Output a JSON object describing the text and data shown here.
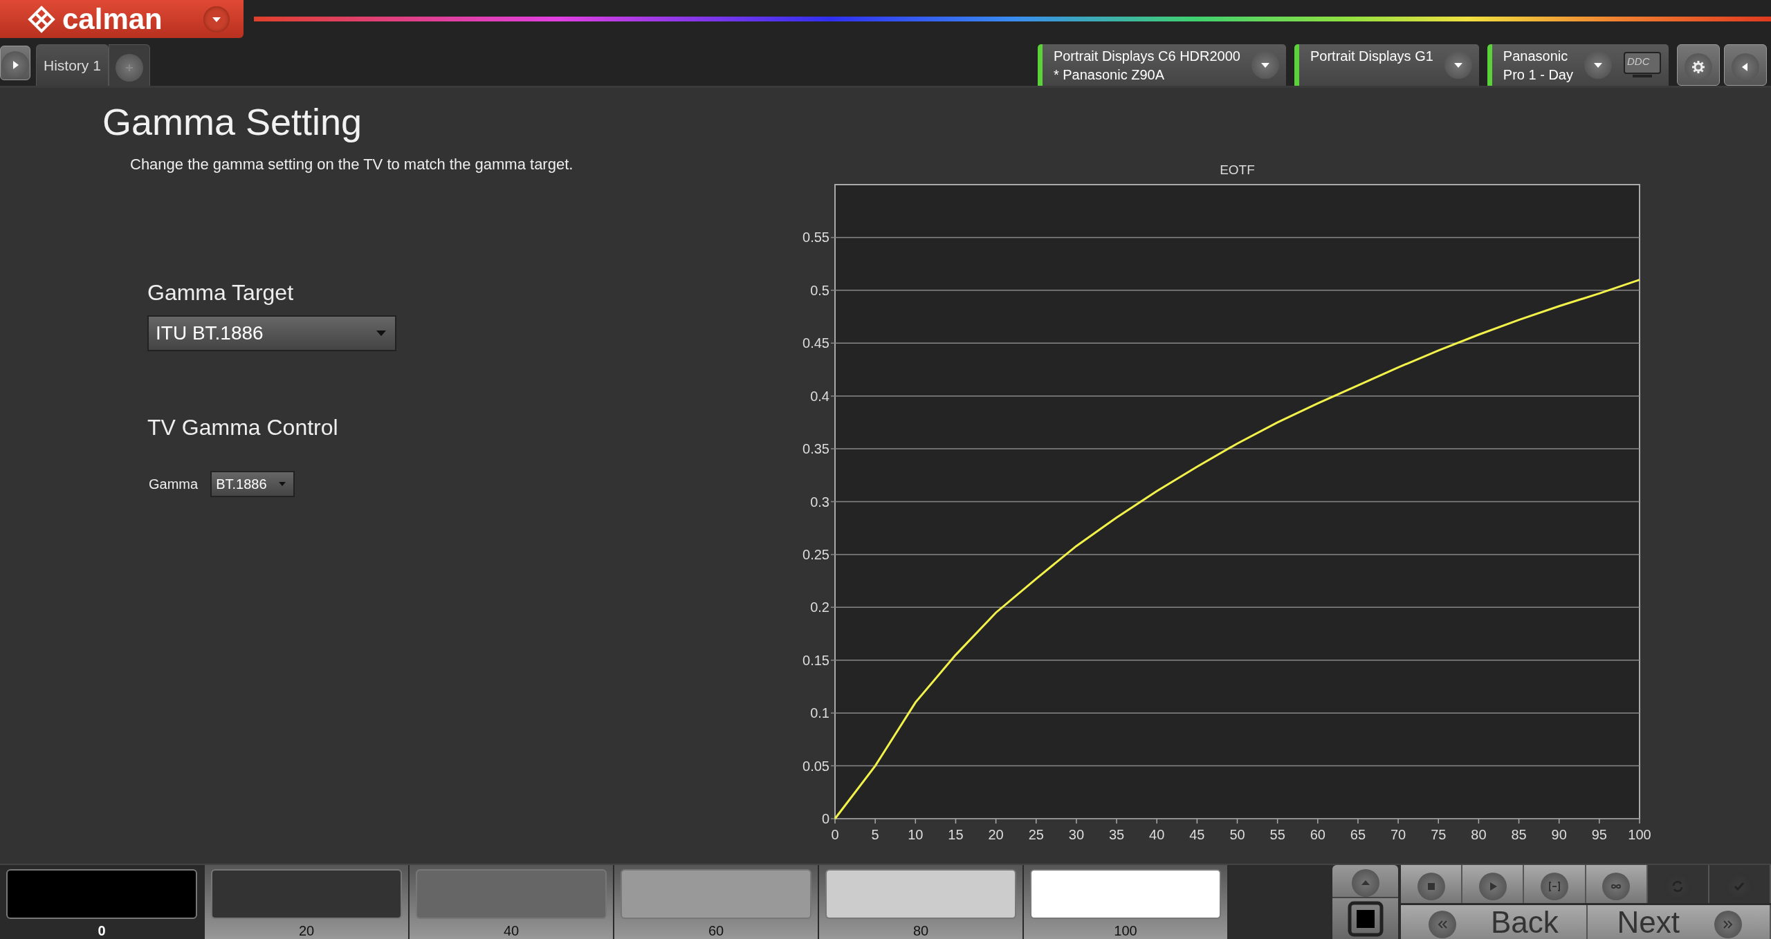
{
  "app": {
    "logo": "calman",
    "ddc": "DDC"
  },
  "tabs": [
    {
      "label": "History 1",
      "selected": true
    }
  ],
  "devices": [
    {
      "lines": [
        "Portrait Displays C6 HDR2000",
        "* Panasonic Z90A"
      ],
      "connected": true
    },
    {
      "lines": [
        "Portrait Displays G1"
      ],
      "connected": true
    },
    {
      "lines": [
        "Panasonic",
        "Pro 1 - Day"
      ],
      "connected": true
    }
  ],
  "page": {
    "title": "Gamma Setting",
    "instruction": "Change the gamma setting on the TV to match the gamma target."
  },
  "gamma_target": {
    "label": "Gamma Target",
    "value": "ITU BT.1886"
  },
  "tv_control": {
    "heading": "TV Gamma Control",
    "fields": [
      {
        "label": "Gamma",
        "value": "BT.1886"
      }
    ]
  },
  "chart_data": {
    "type": "line",
    "title": "EOTF",
    "x": [
      0,
      5,
      10,
      15,
      20,
      25,
      30,
      35,
      40,
      45,
      50,
      55,
      60,
      65,
      70,
      75,
      80,
      85,
      90,
      95,
      100
    ],
    "grid": true,
    "series": [
      {
        "color": "#f2f24a",
        "values": [
          0,
          0.05,
          0.11,
          0.155,
          0.195,
          0.227,
          0.258,
          0.285,
          0.31,
          0.333,
          0.355,
          0.375,
          0.393,
          0.41,
          0.427,
          0.443,
          0.458,
          0.472,
          0.485,
          0.497,
          0.51
        ]
      }
    ],
    "xlim": [
      0,
      100
    ],
    "ylim": [
      0,
      0.6
    ],
    "xticks": [
      0,
      5,
      10,
      15,
      20,
      25,
      30,
      35,
      40,
      45,
      50,
      55,
      60,
      65,
      70,
      75,
      80,
      85,
      90,
      95,
      100
    ],
    "yticks": [
      0,
      0.05,
      0.1,
      0.15,
      0.2,
      0.25,
      0.3,
      0.35,
      0.4,
      0.45,
      0.5,
      0.55
    ]
  },
  "patches": [
    {
      "label": "0",
      "color": "#000000",
      "selected": true
    },
    {
      "label": "20",
      "color": "#333333",
      "selected": false
    },
    {
      "label": "40",
      "color": "#666666",
      "selected": false
    },
    {
      "label": "60",
      "color": "#999999",
      "selected": false
    },
    {
      "label": "80",
      "color": "#cccccc",
      "selected": false
    },
    {
      "label": "100",
      "color": "#ffffff",
      "selected": false
    }
  ],
  "toolbar": [
    {
      "kind": "stop",
      "disabled": false
    },
    {
      "kind": "play",
      "disabled": false
    },
    {
      "kind": "range",
      "disabled": false
    },
    {
      "kind": "loop",
      "disabled": false
    },
    {
      "kind": "refresh",
      "disabled": true
    },
    {
      "kind": "check",
      "disabled": true
    }
  ],
  "nav": {
    "back": "Back",
    "next": "Next"
  }
}
